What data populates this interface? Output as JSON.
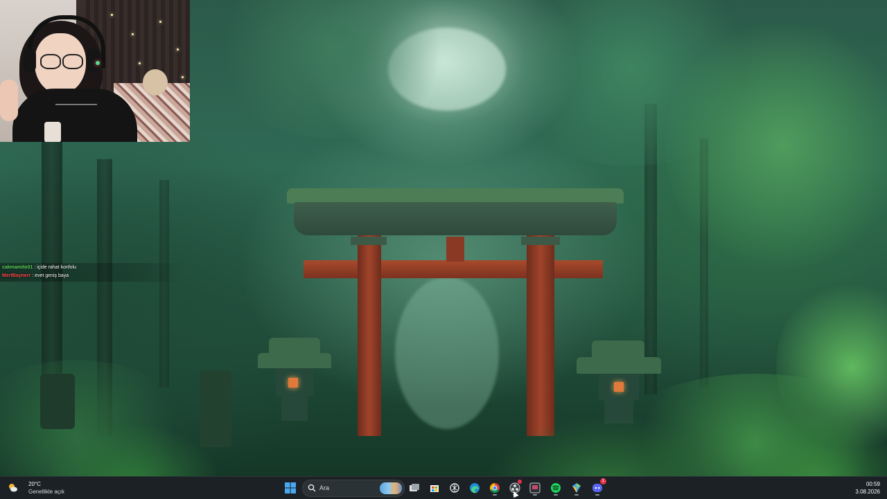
{
  "chat": {
    "messages": [
      {
        "user": "cakmamito01",
        "user_color": "#5bd35b",
        "text": ": içide rahat konfolu"
      },
      {
        "user": "MertBaynerr",
        "user_color": "#ff4a4a",
        "text": ": evet geniş baya"
      }
    ]
  },
  "taskbar": {
    "weather": {
      "temperature": "20°C",
      "description": "Genellikle açık",
      "icon": "partly-sunny-icon"
    },
    "search_label": "Ara",
    "apps": [
      {
        "name": "start-button",
        "icon": "windows-logo-icon"
      },
      {
        "name": "task-view-button",
        "icon": "task-view-icon"
      },
      {
        "name": "store-button",
        "icon": "microsoft-store-icon"
      },
      {
        "name": "chatgpt-button",
        "icon": "openai-icon"
      },
      {
        "name": "edge-button",
        "icon": "edge-icon"
      },
      {
        "name": "chrome-button",
        "icon": "chrome-icon"
      },
      {
        "name": "obs-button",
        "icon": "obs-icon"
      },
      {
        "name": "app-button",
        "icon": "media-app-icon"
      },
      {
        "name": "spotify-button",
        "icon": "spotify-icon"
      },
      {
        "name": "bluestacks-button",
        "icon": "bluestacks-icon"
      },
      {
        "name": "discord-button",
        "icon": "discord-icon",
        "badge": "1"
      }
    ],
    "clock": {
      "time": "00:59",
      "date": "3.08.2026"
    }
  },
  "colors": {
    "taskbar_bg": "#1b2124",
    "torii_red": "#9a3a26",
    "forest_green": "#2f6a55"
  }
}
